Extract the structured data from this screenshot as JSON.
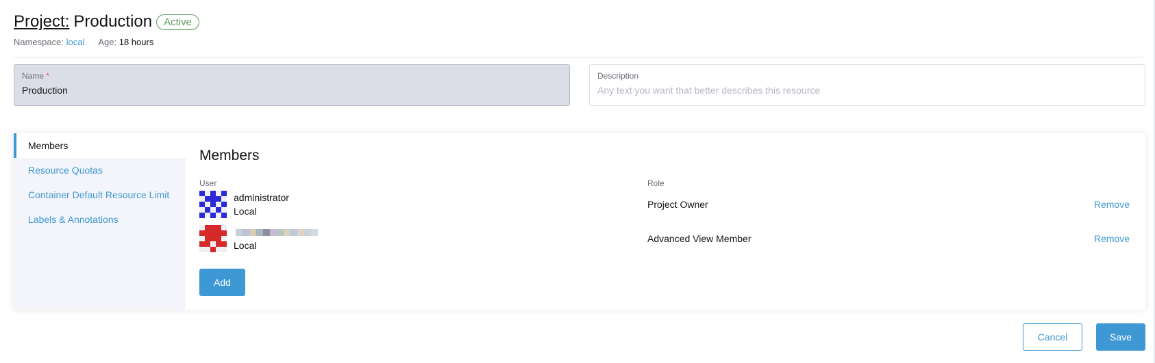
{
  "header": {
    "title_prefix": "Project:",
    "title_name": "Production",
    "status": "Active",
    "namespace_label": "Namespace:",
    "namespace_value": "local",
    "age_label": "Age:",
    "age_value": "18 hours"
  },
  "form": {
    "name_label": "Name",
    "name_required": "*",
    "name_value": "Production",
    "description_label": "Description",
    "description_placeholder": "Any text you want that better describes this resource"
  },
  "sidebar": {
    "items": [
      {
        "label": "Members"
      },
      {
        "label": "Resource Quotas"
      },
      {
        "label": "Container Default Resource Limit"
      },
      {
        "label": "Labels & Annotations"
      }
    ]
  },
  "members": {
    "title": "Members",
    "col_user": "User",
    "col_role": "Role",
    "rows": [
      {
        "user": "administrator",
        "provider": "Local",
        "role": "Project Owner",
        "action": "Remove"
      },
      {
        "user": "",
        "provider": "Local",
        "role": "Advanced View Member",
        "action": "Remove"
      }
    ],
    "add_label": "Add"
  },
  "footer": {
    "cancel_label": "Cancel",
    "save_label": "Save"
  },
  "colors": {
    "accent": "#3d98d3",
    "success": "#5d995d",
    "avatar_1": "#2a2ad6",
    "avatar_2": "#d62a2a"
  }
}
